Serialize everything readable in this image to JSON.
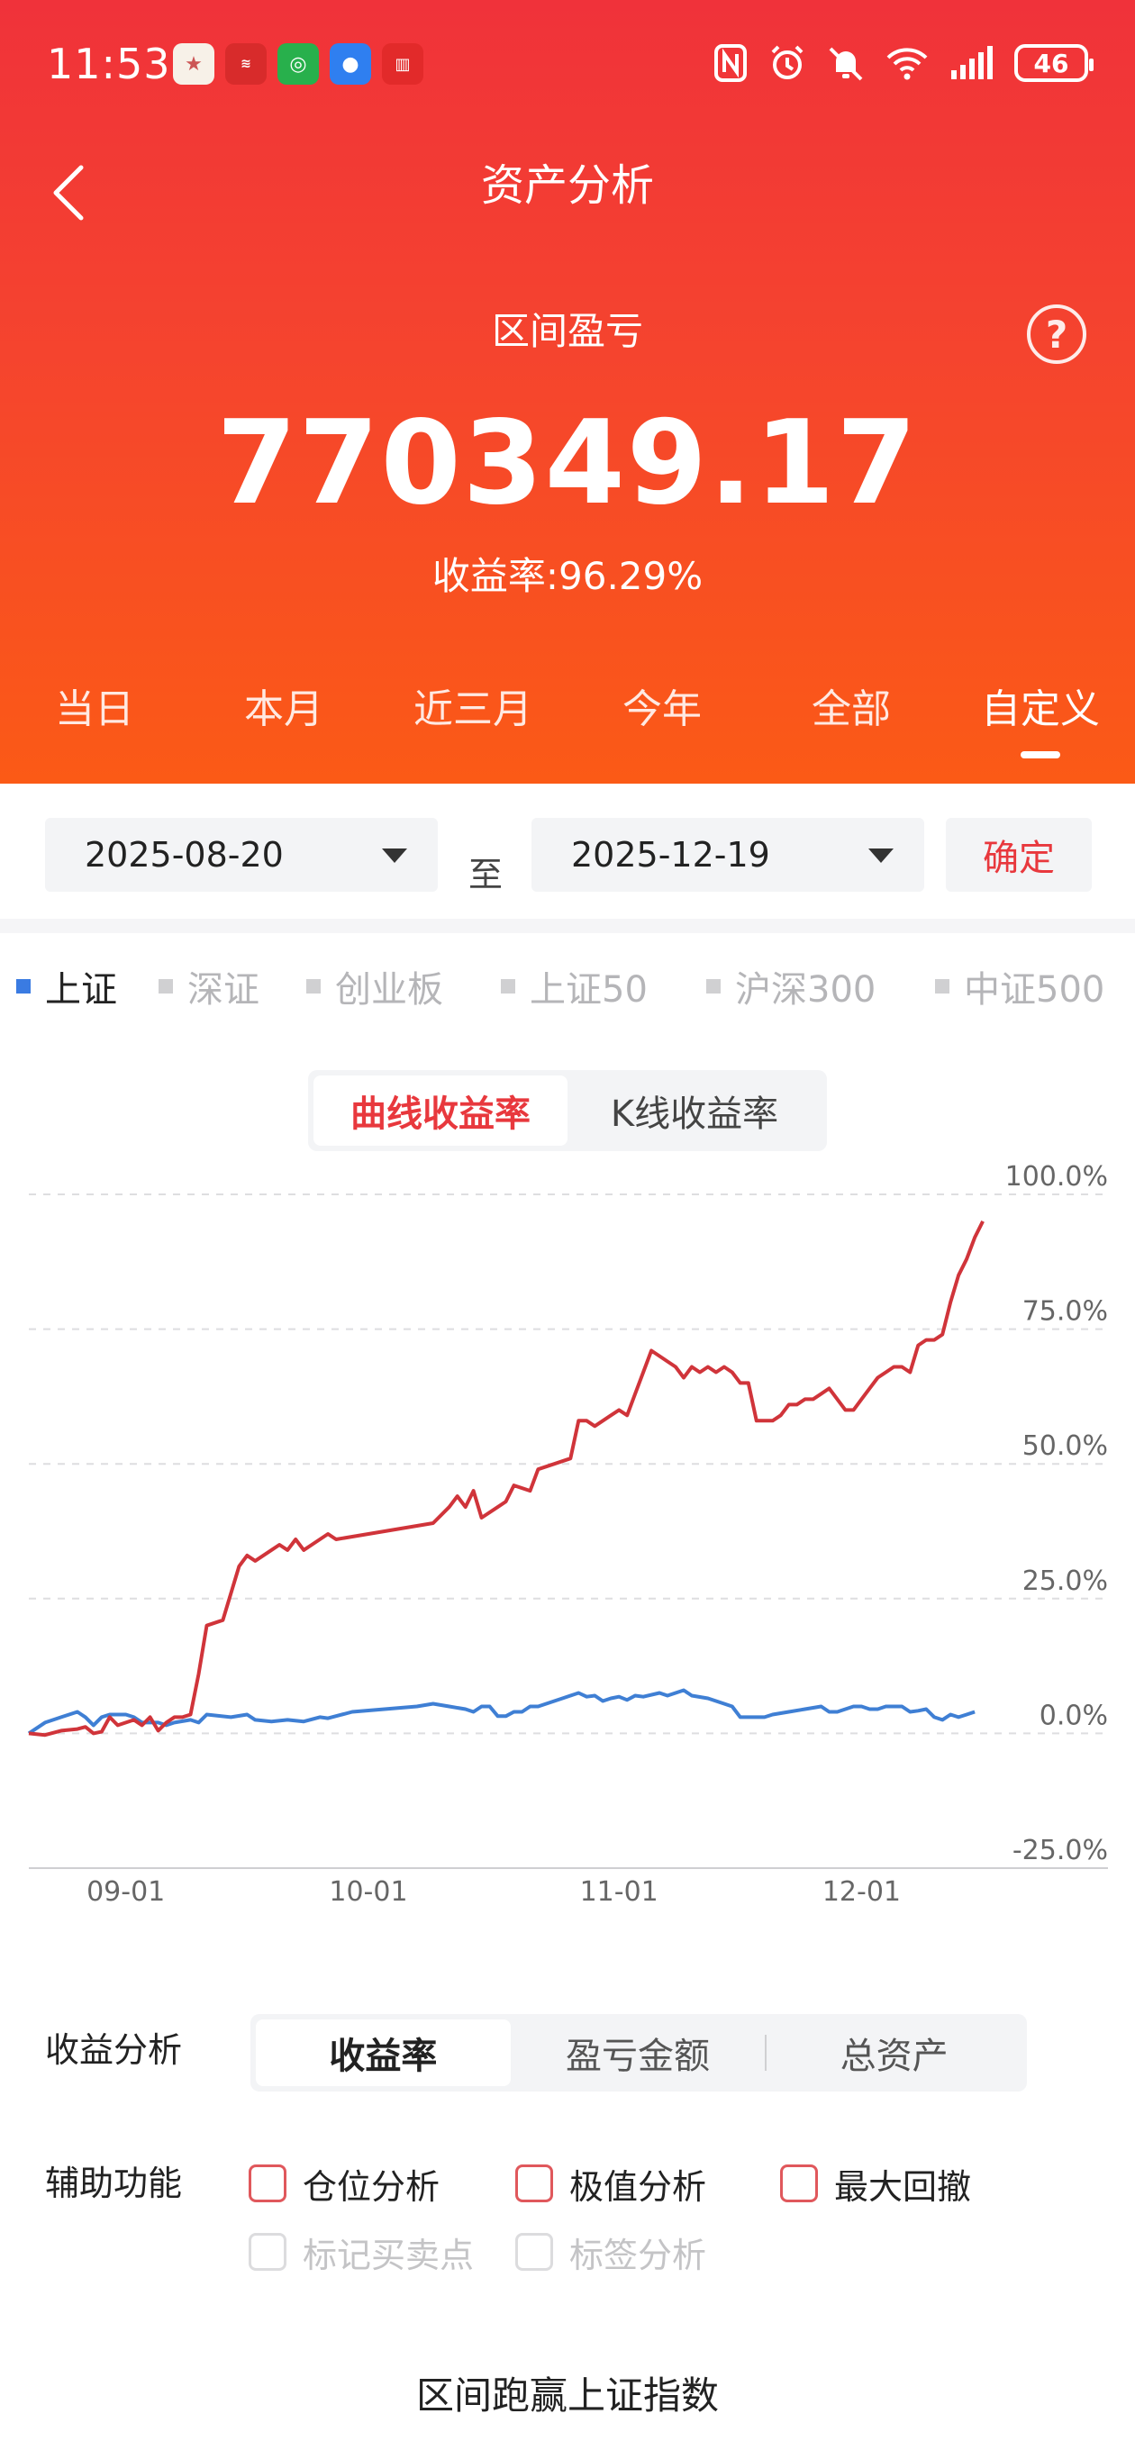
{
  "status_bar": {
    "time": "11:53",
    "battery": "46"
  },
  "header": {
    "title": "资产分析"
  },
  "summary": {
    "label": "区间盈亏",
    "profit": "770349.17",
    "yield_text": "收益率:96.29%"
  },
  "periods": [
    "当日",
    "本月",
    "近三月",
    "今年",
    "全部",
    "自定义"
  ],
  "active_period": "自定义",
  "date_range": {
    "start": "2025-08-20",
    "separator": "至",
    "end": "2025-12-19",
    "confirm_label": "确定"
  },
  "indices": [
    "上证",
    "深证",
    "创业板",
    "上证50",
    "沪深300",
    "中证500"
  ],
  "active_index": "上证",
  "chart_toggle": {
    "curve": "曲线收益率",
    "kline": "K线收益率"
  },
  "chart_data": {
    "type": "line",
    "ylim": [
      -25,
      100
    ],
    "y_ticks": [
      "100.0%",
      "75.0%",
      "50.0%",
      "25.0%",
      "0.0%",
      "-25.0%"
    ],
    "x_ticks": [
      {
        "label": "09-01",
        "x": 12
      },
      {
        "label": "10-01",
        "x": 42
      },
      {
        "label": "11-01",
        "x": 73
      },
      {
        "label": "12-01",
        "x": 103
      }
    ],
    "x_range": [
      0,
      121
    ],
    "series": [
      {
        "color": "#d0343a",
        "points": [
          [
            0,
            0
          ],
          [
            2,
            -0.3
          ],
          [
            4,
            0.5
          ],
          [
            6,
            0.8
          ],
          [
            7,
            1.2
          ],
          [
            8,
            0
          ],
          [
            9,
            0.3
          ],
          [
            10,
            3
          ],
          [
            11,
            1.5
          ],
          [
            12,
            2
          ],
          [
            13,
            2.5
          ],
          [
            14,
            1.5
          ],
          [
            15,
            3
          ],
          [
            16,
            0.5
          ],
          [
            17,
            2
          ],
          [
            18,
            3
          ],
          [
            19,
            3
          ],
          [
            20,
            3.5
          ],
          [
            21,
            11
          ],
          [
            22,
            20
          ],
          [
            24,
            21
          ],
          [
            25,
            26
          ],
          [
            26,
            31
          ],
          [
            27,
            33
          ],
          [
            28,
            32
          ],
          [
            30,
            34
          ],
          [
            31,
            35
          ],
          [
            32,
            34
          ],
          [
            33,
            36
          ],
          [
            34,
            34
          ],
          [
            35,
            35
          ],
          [
            37,
            37
          ],
          [
            38,
            36
          ],
          [
            42,
            37
          ],
          [
            46,
            38
          ],
          [
            50,
            39
          ],
          [
            52,
            42
          ],
          [
            53,
            44
          ],
          [
            54,
            42
          ],
          [
            55,
            45
          ],
          [
            56,
            40
          ],
          [
            58,
            42
          ],
          [
            59,
            43
          ],
          [
            60,
            46
          ],
          [
            62,
            45
          ],
          [
            63,
            49
          ],
          [
            65,
            50
          ],
          [
            67,
            51
          ],
          [
            68,
            58
          ],
          [
            69,
            58
          ],
          [
            70,
            57
          ],
          [
            72,
            59
          ],
          [
            73,
            60
          ],
          [
            74,
            59
          ],
          [
            75,
            63
          ],
          [
            76,
            67
          ],
          [
            77,
            71
          ],
          [
            78,
            70
          ],
          [
            79,
            69
          ],
          [
            80,
            68
          ],
          [
            81,
            66
          ],
          [
            82,
            68
          ],
          [
            83,
            67
          ],
          [
            84,
            68
          ],
          [
            85,
            67
          ],
          [
            86,
            68
          ],
          [
            87,
            67
          ],
          [
            88,
            65
          ],
          [
            89,
            65
          ],
          [
            90,
            58
          ],
          [
            91,
            58
          ],
          [
            92,
            58
          ],
          [
            93,
            59
          ],
          [
            94,
            61
          ],
          [
            95,
            61
          ],
          [
            96,
            62
          ],
          [
            97,
            62
          ],
          [
            98,
            63
          ],
          [
            99,
            64
          ],
          [
            100,
            62
          ],
          [
            101,
            60
          ],
          [
            102,
            60
          ],
          [
            103,
            62
          ],
          [
            104,
            64
          ],
          [
            105,
            66
          ],
          [
            106,
            67
          ],
          [
            107,
            68
          ],
          [
            108,
            68
          ],
          [
            109,
            67
          ],
          [
            110,
            72
          ],
          [
            111,
            73
          ],
          [
            112,
            73
          ],
          [
            113,
            74
          ],
          [
            114,
            80
          ],
          [
            115,
            85
          ],
          [
            116,
            88
          ],
          [
            117,
            92
          ],
          [
            118,
            95
          ]
        ]
      },
      {
        "color": "#3f7fd4",
        "points": [
          [
            0,
            0
          ],
          [
            2,
            2
          ],
          [
            4,
            3
          ],
          [
            6,
            4
          ],
          [
            7,
            3
          ],
          [
            8,
            1.5
          ],
          [
            9,
            3
          ],
          [
            10,
            3.5
          ],
          [
            12,
            3.5
          ],
          [
            13,
            3
          ],
          [
            14,
            2
          ],
          [
            15,
            2
          ],
          [
            16,
            2
          ],
          [
            17,
            1.5
          ],
          [
            18,
            2
          ],
          [
            20,
            2.5
          ],
          [
            21,
            2
          ],
          [
            22,
            3.5
          ],
          [
            25,
            3
          ],
          [
            27,
            3.5
          ],
          [
            28,
            2.5
          ],
          [
            30,
            2.2
          ],
          [
            32,
            2.5
          ],
          [
            34,
            2.2
          ],
          [
            36,
            3
          ],
          [
            37,
            2.8
          ],
          [
            40,
            4
          ],
          [
            44,
            4.5
          ],
          [
            48,
            5
          ],
          [
            50,
            5.5
          ],
          [
            52,
            5
          ],
          [
            54,
            4.5
          ],
          [
            55,
            4
          ],
          [
            56,
            5
          ],
          [
            57,
            5
          ],
          [
            58,
            3.2
          ],
          [
            59,
            3.2
          ],
          [
            60,
            4
          ],
          [
            61,
            4
          ],
          [
            62,
            5
          ],
          [
            63,
            5
          ],
          [
            65,
            6
          ],
          [
            66,
            6.5
          ],
          [
            67,
            7
          ],
          [
            68,
            7.5
          ],
          [
            69,
            6.8
          ],
          [
            70,
            7
          ],
          [
            71,
            6
          ],
          [
            72,
            6.5
          ],
          [
            73,
            6.8
          ],
          [
            74,
            6.2
          ],
          [
            75,
            7
          ],
          [
            76,
            6.8
          ],
          [
            78,
            7.5
          ],
          [
            79,
            7
          ],
          [
            80,
            7.5
          ],
          [
            81,
            8
          ],
          [
            82,
            7
          ],
          [
            84,
            6.5
          ],
          [
            85,
            6
          ],
          [
            86,
            5.5
          ],
          [
            87,
            5
          ],
          [
            88,
            3
          ],
          [
            89,
            3
          ],
          [
            90,
            3
          ],
          [
            91,
            3
          ],
          [
            92,
            3.5
          ],
          [
            94,
            4
          ],
          [
            96,
            4.5
          ],
          [
            98,
            5
          ],
          [
            99,
            4
          ],
          [
            100,
            4
          ],
          [
            101,
            4.5
          ],
          [
            102,
            5
          ],
          [
            103,
            5
          ],
          [
            104,
            4.5
          ],
          [
            105,
            4.5
          ],
          [
            106,
            5
          ],
          [
            108,
            5
          ],
          [
            109,
            4
          ],
          [
            110,
            4.2
          ],
          [
            111,
            4.5
          ],
          [
            112,
            3
          ],
          [
            113,
            2.5
          ],
          [
            114,
            3.5
          ],
          [
            115,
            3
          ],
          [
            116,
            3.5
          ],
          [
            117,
            4
          ]
        ]
      }
    ]
  },
  "analysis": {
    "label": "收益分析",
    "options": [
      "收益率",
      "盈亏金额",
      "总资产"
    ],
    "active": "收益率"
  },
  "assist": {
    "label": "辅助功能",
    "options": [
      "仓位分析",
      "极值分析",
      "最大回撤"
    ],
    "disabled_options": [
      "标记买卖点",
      "标签分析"
    ]
  },
  "footer": {
    "text": "区间跑赢上证指数"
  }
}
